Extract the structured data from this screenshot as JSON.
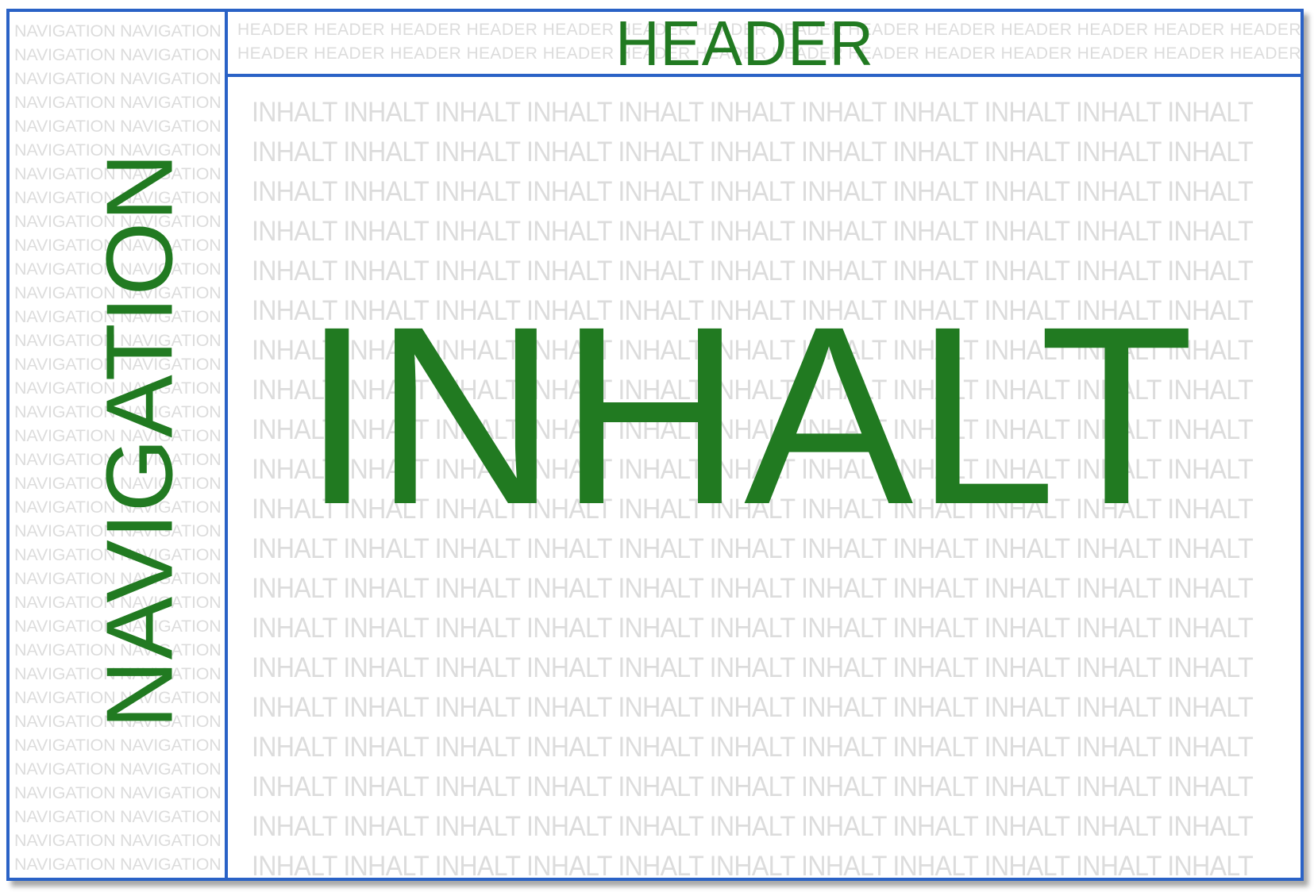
{
  "navigation": {
    "label": "NAVIGATION",
    "pattern_word": "NAVIGATION"
  },
  "header": {
    "label": "HEADER",
    "pattern_word": "HEADER"
  },
  "content": {
    "label": "INHALT",
    "pattern_word": "INHALT"
  },
  "colors": {
    "label_green": "#217a21",
    "border_blue": "#2a62c6",
    "pattern_gray": "#dcdcdc"
  }
}
